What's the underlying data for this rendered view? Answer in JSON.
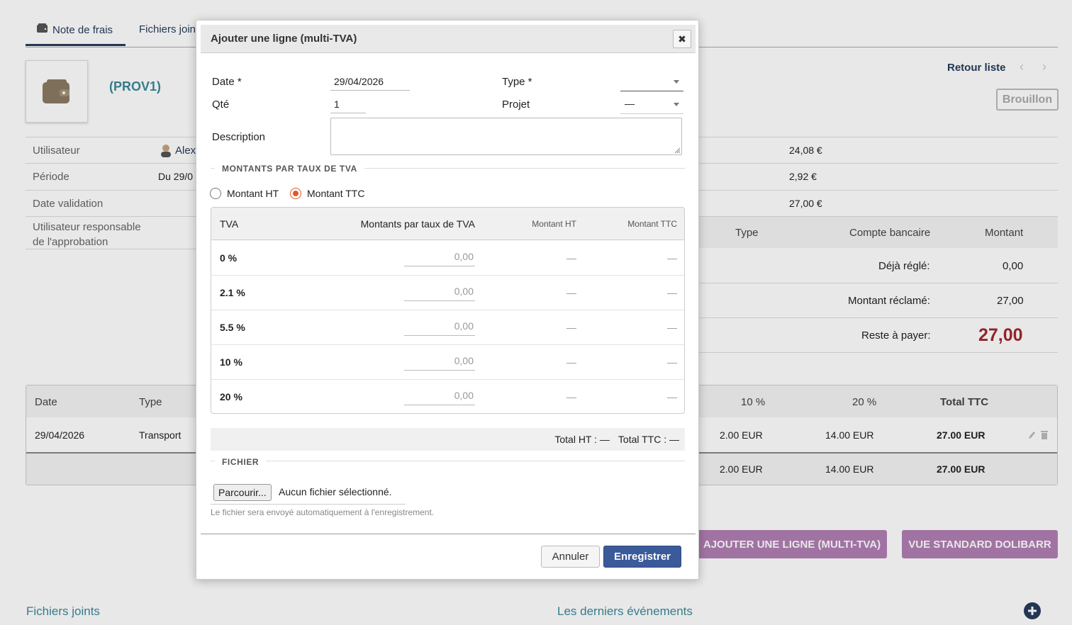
{
  "tabs": [
    {
      "label": "Note de frais"
    },
    {
      "label": "Fichiers join"
    }
  ],
  "header": {
    "ref": "(PROV1)",
    "back_link": "Retour liste",
    "prev_arrow": "‹",
    "next_arrow": "›",
    "status": "Brouillon"
  },
  "info": {
    "user_label": "Utilisateur",
    "user_value": "Alex",
    "period_label": "Période",
    "period_value": "Du 29/0",
    "validation_label": "Date validation",
    "approver_label_1": "Utilisateur responsable",
    "approver_label_2": "de l'approbation"
  },
  "amounts": {
    "total_ht": "24,08 €",
    "total_tva": "2,92 €",
    "total_ttc": "27,00 €"
  },
  "payments": {
    "col_type": "Type",
    "col_account": "Compte bancaire",
    "col_amount": "Montant",
    "already_paid_label": "Déjà réglé:",
    "already_paid_value": "0,00",
    "claimed_label": "Montant réclamé:",
    "claimed_value": "27,00",
    "remaining_label": "Reste à payer:",
    "remaining_value": "27,00"
  },
  "lines_table": {
    "headers": {
      "date": "Date",
      "type": "Type",
      "vat10": "10 %",
      "vat20": "20 %",
      "total": "Total TTC"
    },
    "row": {
      "date": "29/04/2026",
      "type": "Transport",
      "vat10": "2.00 EUR",
      "vat20": "14.00 EUR",
      "total": "27.00 EUR"
    },
    "totals": {
      "vat10": "2.00 EUR",
      "vat20": "14.00 EUR",
      "total": "27.00 EUR"
    }
  },
  "buttons": {
    "add_multi": "Ajouter une ligne (multi-TVA)",
    "standard_view": "Vue standard Dolibarr"
  },
  "footer": {
    "files": "Fichiers joints",
    "events": "Les derniers événements"
  },
  "modal": {
    "title": "Ajouter une ligne (multi-TVA)",
    "close": "✖",
    "date_label": "Date *",
    "date_value": "29/04/2026",
    "type_label": "Type *",
    "type_value": "",
    "qty_label": "Qté",
    "qty_value": "1",
    "project_label": "Projet",
    "project_value": "—",
    "description_label": "Description",
    "section_amounts": "MONTANTS PAR TAUX DE TVA",
    "radio_ht": "Montant HT",
    "radio_ttc": "Montant TTC",
    "radio_selected": "ttc",
    "vat_headers": {
      "rate": "TVA",
      "amounts": "Montants par taux de TVA",
      "ht": "Montant HT",
      "ttc": "Montant TTC"
    },
    "vat_rows": [
      {
        "rate": "0 %",
        "placeholder": "0,00",
        "ht": "—",
        "ttc": "—"
      },
      {
        "rate": "2.1 %",
        "placeholder": "0,00",
        "ht": "—",
        "ttc": "—"
      },
      {
        "rate": "5.5 %",
        "placeholder": "0,00",
        "ht": "—",
        "ttc": "—"
      },
      {
        "rate": "10 %",
        "placeholder": "0,00",
        "ht": "—",
        "ttc": "—"
      },
      {
        "rate": "20 %",
        "placeholder": "0,00",
        "ht": "—",
        "ttc": "—"
      }
    ],
    "total_ht": "Total HT : —",
    "total_ttc": "Total TTC : —",
    "section_file": "FICHIER",
    "browse_label": "Parcourir...",
    "no_file": "Aucun fichier sélectionné.",
    "file_hint": "Le fichier sera envoyé automatiquement à l'enregistrement.",
    "cancel": "Annuler",
    "save": "Enregistrer"
  },
  "colors": {
    "primary": "#263c5c",
    "accent_teal": "#3a8a9a",
    "purple_button": "#b17fb4",
    "save_button": "#3a5a9a",
    "remaining_red": "#a0282e",
    "radio_orange": "#e05a2a"
  },
  "icons": [
    "wallet-icon",
    "user-avatar-icon",
    "close-icon",
    "edit-icon",
    "delete-icon",
    "plus-circle-icon",
    "resize-grip-icon"
  ]
}
